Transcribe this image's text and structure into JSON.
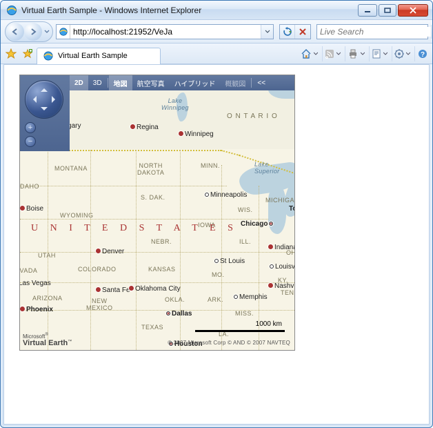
{
  "window": {
    "title": "Virtual Earth Sample - Windows Internet Explorer"
  },
  "nav": {
    "url": "http://localhost:21952/VeJa",
    "search_placeholder": "Live Search"
  },
  "tab": {
    "title": "Virtual Earth Sample"
  },
  "map_controls": {
    "view_2d": "2D",
    "view_3d": "3D",
    "road": "地図",
    "aerial": "航空写真",
    "hybrid": "ハイブリッド",
    "birdseye": "概観図",
    "collapse": "<<"
  },
  "map": {
    "country": "U N I T E D   S T A T E S",
    "provinces": {
      "ontario": "O N T A R I O"
    },
    "water": {
      "winnipeg": "Lake\nWinnipeg",
      "superior": "Lake\nSuperior"
    },
    "states": {
      "montana": "MONTANA",
      "ndak": "NORTH\nDAKOTA",
      "sdak": "S. DAK.",
      "minn": "MINN.",
      "wis": "WIS.",
      "mich": "MICHIGAN",
      "idaho": "DAHO",
      "wyoming": "WYOMING",
      "nebr": "NEBR.",
      "iowa": "IOWA",
      "ill": "ILL.",
      "ohio": "OHI",
      "utah": "UTAH",
      "colorado": "COLORADO",
      "kansas": "KANSAS",
      "mo": "MO.",
      "ky": "KY.",
      "nevada": "NEVADA",
      "arizona": "ARIZONA",
      "nm": "NEW\nMEXICO",
      "okla": "OKLA.",
      "ark": "ARK.",
      "tenn": "TENN",
      "texas": "TEXAS",
      "la": "LA.",
      "miss": "MISS."
    },
    "cities": {
      "calgary": "Calgary",
      "regina": "Regina",
      "winnipeg": "Winnipeg",
      "boise": "Boise",
      "minneapolis": "Minneapolis",
      "chicago": "Chicago",
      "toronto": "To",
      "denver": "Denver",
      "stlouis": "St Louis",
      "indianapolis": "Indianap",
      "lasvegas": "Las Vegas",
      "santafe": "Santa Fe",
      "okc": "Oklahoma City",
      "memphis": "Memphis",
      "nashville": "Nashvi",
      "phoenix": "Phoenix",
      "dallas": "Dallas",
      "houston": "Houston",
      "louisville": "Louisvil"
    },
    "scale": "1000 km",
    "logo_line1": "Microsoft",
    "logo_line2": "Virtual Earth",
    "copyright": "© 2007 Microsoft Corp   © AND   © 2007 NAVTEQ"
  }
}
